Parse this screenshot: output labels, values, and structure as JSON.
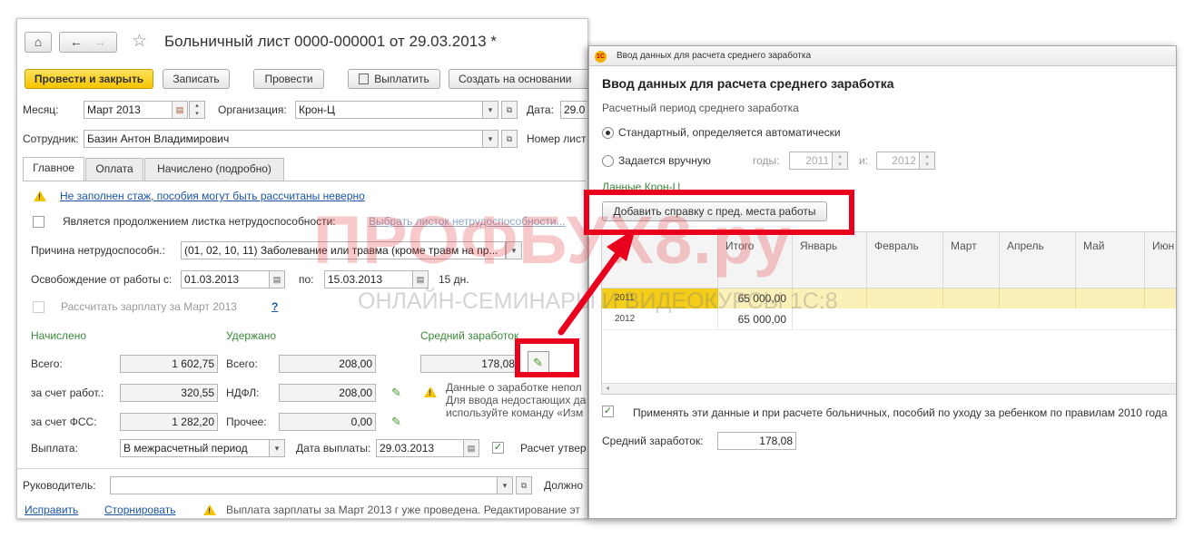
{
  "main": {
    "nav": {
      "home": "⌂",
      "back": "←",
      "forward": "→",
      "star": "☆"
    },
    "title": "Больничный лист 0000-000001 от 29.03.2013 *",
    "toolbar": {
      "post_close": "Провести и закрыть",
      "write": "Записать",
      "post": "Провести",
      "pay": "Выплатить",
      "create_based": "Создать на основании"
    },
    "month_label": "Месяц:",
    "month_value": "Март 2013",
    "org_label": "Организация:",
    "org_value": "Крон-Ц",
    "date_label": "Дата:",
    "date_value": "29.0",
    "employee_label": "Сотрудник:",
    "employee_value": "Базин Антон Владимирович",
    "number_label": "Номер лист",
    "tabs": [
      "Главное",
      "Оплата",
      "Начислено (подробно)"
    ],
    "warning_link": "Не заполнен стаж, пособия могут быть рассчитаны неверно",
    "continuation_label": "Является продолжением листка нетрудоспособности:",
    "continuation_link": "Выбрать листок нетрудоспособности...",
    "reason_label": "Причина нетрудоспособн.:",
    "reason_value": "(01, 02, 10, 11) Заболевание или травма (кроме травм на пр...",
    "release_label": "Освобождение от работы с:",
    "release_from": "01.03.2013",
    "release_to_label": "по:",
    "release_to": "15.03.2013",
    "days": "15 дн.",
    "calc_label": "Рассчитать зарплату за Март 2013",
    "help": "?",
    "accrued_title": "Начислено",
    "withheld_title": "Удержано",
    "avg_title": "Средний заработок",
    "total_label": "Всего:",
    "total_accrued": "1 602,75",
    "total_withheld_label": "Всего:",
    "total_withheld": "208,00",
    "avg_value": "178,08",
    "employer_label": "за счет работ.:",
    "employer_value": "320,55",
    "ndfl_label": "НДФЛ:",
    "ndfl_value": "208,00",
    "avg_note_1": "Данные о заработке непол",
    "avg_note_2": "Для ввода недостающих да",
    "avg_note_3": "используйте команду «Изм",
    "fss_label": "за счет ФСС:",
    "fss_value": "1 282,20",
    "other_label": "Прочее:",
    "other_value": "0,00",
    "payout_label": "Выплата:",
    "payout_value": "В межрасчетный период",
    "payout_date_label": "Дата выплаты:",
    "payout_date": "29.03.2013",
    "calc_approved": "Расчет утвер",
    "manager_label": "Руководитель:",
    "position_label": "Должно",
    "fix_link": "Исправить",
    "reverse_link": "Сторнировать",
    "footer_note": "Выплата зарплаты за Март 2013 г уже проведена. Редактирование эт"
  },
  "dialog": {
    "window_title": "Ввод данных для расчета среднего заработка",
    "heading": "Ввод данных для расчета среднего заработка",
    "period_label": "Расчетный период среднего заработка",
    "radio_standard": "Стандартный, определяется автоматически",
    "radio_manual": "Задается вручную",
    "years_label": "годы:",
    "year_from": "2011",
    "and_label": "и:",
    "year_to": "2012",
    "org_data": "Данные Крон-Ц",
    "add_button": "Добавить справку с пред. места работы",
    "columns": [
      "Итого",
      "Январь",
      "Февраль",
      "Март",
      "Апрель",
      "Май",
      "Июн"
    ],
    "rows": [
      {
        "year": "2011",
        "total": "65 000,00"
      },
      {
        "year": "2012",
        "total": "65 000,00"
      }
    ],
    "apply_label": "Применять эти данные и при расчете больничных, пособий по уходу за ребенком по правилам 2010 года",
    "avg_label": "Средний заработок:",
    "avg_value": "178,08"
  },
  "watermark": {
    "brand": "ПРОФБУХ8.ру",
    "subtitle": "ОНЛАЙН-СЕМИНАРЫ И ВИДЕОКУРСЫ 1С:8"
  },
  "colors": {
    "highlight": "#e8001c",
    "accent": "#f5c400",
    "link": "#1a55a8",
    "group": "#3a8a3a"
  }
}
